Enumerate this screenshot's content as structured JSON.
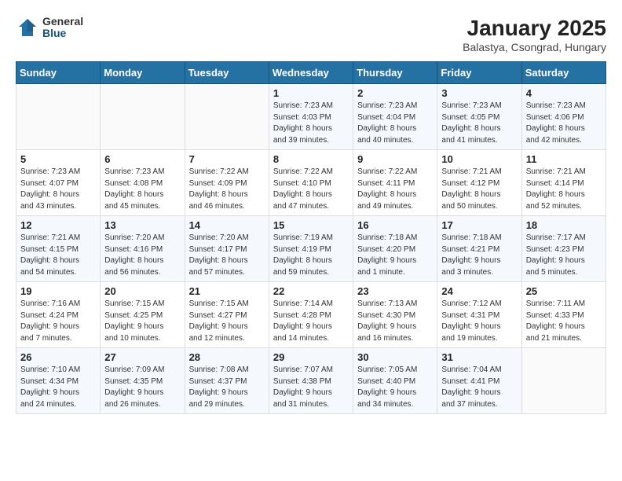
{
  "header": {
    "logo_general": "General",
    "logo_blue": "Blue",
    "main_title": "January 2025",
    "subtitle": "Balastya, Csongrad, Hungary"
  },
  "weekdays": [
    "Sunday",
    "Monday",
    "Tuesday",
    "Wednesday",
    "Thursday",
    "Friday",
    "Saturday"
  ],
  "weeks": [
    [
      {
        "day": "",
        "info": ""
      },
      {
        "day": "",
        "info": ""
      },
      {
        "day": "",
        "info": ""
      },
      {
        "day": "1",
        "info": "Sunrise: 7:23 AM\nSunset: 4:03 PM\nDaylight: 8 hours\nand 39 minutes."
      },
      {
        "day": "2",
        "info": "Sunrise: 7:23 AM\nSunset: 4:04 PM\nDaylight: 8 hours\nand 40 minutes."
      },
      {
        "day": "3",
        "info": "Sunrise: 7:23 AM\nSunset: 4:05 PM\nDaylight: 8 hours\nand 41 minutes."
      },
      {
        "day": "4",
        "info": "Sunrise: 7:23 AM\nSunset: 4:06 PM\nDaylight: 8 hours\nand 42 minutes."
      }
    ],
    [
      {
        "day": "5",
        "info": "Sunrise: 7:23 AM\nSunset: 4:07 PM\nDaylight: 8 hours\nand 43 minutes."
      },
      {
        "day": "6",
        "info": "Sunrise: 7:23 AM\nSunset: 4:08 PM\nDaylight: 8 hours\nand 45 minutes."
      },
      {
        "day": "7",
        "info": "Sunrise: 7:22 AM\nSunset: 4:09 PM\nDaylight: 8 hours\nand 46 minutes."
      },
      {
        "day": "8",
        "info": "Sunrise: 7:22 AM\nSunset: 4:10 PM\nDaylight: 8 hours\nand 47 minutes."
      },
      {
        "day": "9",
        "info": "Sunrise: 7:22 AM\nSunset: 4:11 PM\nDaylight: 8 hours\nand 49 minutes."
      },
      {
        "day": "10",
        "info": "Sunrise: 7:21 AM\nSunset: 4:12 PM\nDaylight: 8 hours\nand 50 minutes."
      },
      {
        "day": "11",
        "info": "Sunrise: 7:21 AM\nSunset: 4:14 PM\nDaylight: 8 hours\nand 52 minutes."
      }
    ],
    [
      {
        "day": "12",
        "info": "Sunrise: 7:21 AM\nSunset: 4:15 PM\nDaylight: 8 hours\nand 54 minutes."
      },
      {
        "day": "13",
        "info": "Sunrise: 7:20 AM\nSunset: 4:16 PM\nDaylight: 8 hours\nand 56 minutes."
      },
      {
        "day": "14",
        "info": "Sunrise: 7:20 AM\nSunset: 4:17 PM\nDaylight: 8 hours\nand 57 minutes."
      },
      {
        "day": "15",
        "info": "Sunrise: 7:19 AM\nSunset: 4:19 PM\nDaylight: 8 hours\nand 59 minutes."
      },
      {
        "day": "16",
        "info": "Sunrise: 7:18 AM\nSunset: 4:20 PM\nDaylight: 9 hours\nand 1 minute."
      },
      {
        "day": "17",
        "info": "Sunrise: 7:18 AM\nSunset: 4:21 PM\nDaylight: 9 hours\nand 3 minutes."
      },
      {
        "day": "18",
        "info": "Sunrise: 7:17 AM\nSunset: 4:23 PM\nDaylight: 9 hours\nand 5 minutes."
      }
    ],
    [
      {
        "day": "19",
        "info": "Sunrise: 7:16 AM\nSunset: 4:24 PM\nDaylight: 9 hours\nand 7 minutes."
      },
      {
        "day": "20",
        "info": "Sunrise: 7:15 AM\nSunset: 4:25 PM\nDaylight: 9 hours\nand 10 minutes."
      },
      {
        "day": "21",
        "info": "Sunrise: 7:15 AM\nSunset: 4:27 PM\nDaylight: 9 hours\nand 12 minutes."
      },
      {
        "day": "22",
        "info": "Sunrise: 7:14 AM\nSunset: 4:28 PM\nDaylight: 9 hours\nand 14 minutes."
      },
      {
        "day": "23",
        "info": "Sunrise: 7:13 AM\nSunset: 4:30 PM\nDaylight: 9 hours\nand 16 minutes."
      },
      {
        "day": "24",
        "info": "Sunrise: 7:12 AM\nSunset: 4:31 PM\nDaylight: 9 hours\nand 19 minutes."
      },
      {
        "day": "25",
        "info": "Sunrise: 7:11 AM\nSunset: 4:33 PM\nDaylight: 9 hours\nand 21 minutes."
      }
    ],
    [
      {
        "day": "26",
        "info": "Sunrise: 7:10 AM\nSunset: 4:34 PM\nDaylight: 9 hours\nand 24 minutes."
      },
      {
        "day": "27",
        "info": "Sunrise: 7:09 AM\nSunset: 4:35 PM\nDaylight: 9 hours\nand 26 minutes."
      },
      {
        "day": "28",
        "info": "Sunrise: 7:08 AM\nSunset: 4:37 PM\nDaylight: 9 hours\nand 29 minutes."
      },
      {
        "day": "29",
        "info": "Sunrise: 7:07 AM\nSunset: 4:38 PM\nDaylight: 9 hours\nand 31 minutes."
      },
      {
        "day": "30",
        "info": "Sunrise: 7:05 AM\nSunset: 4:40 PM\nDaylight: 9 hours\nand 34 minutes."
      },
      {
        "day": "31",
        "info": "Sunrise: 7:04 AM\nSunset: 4:41 PM\nDaylight: 9 hours\nand 37 minutes."
      },
      {
        "day": "",
        "info": ""
      }
    ]
  ]
}
